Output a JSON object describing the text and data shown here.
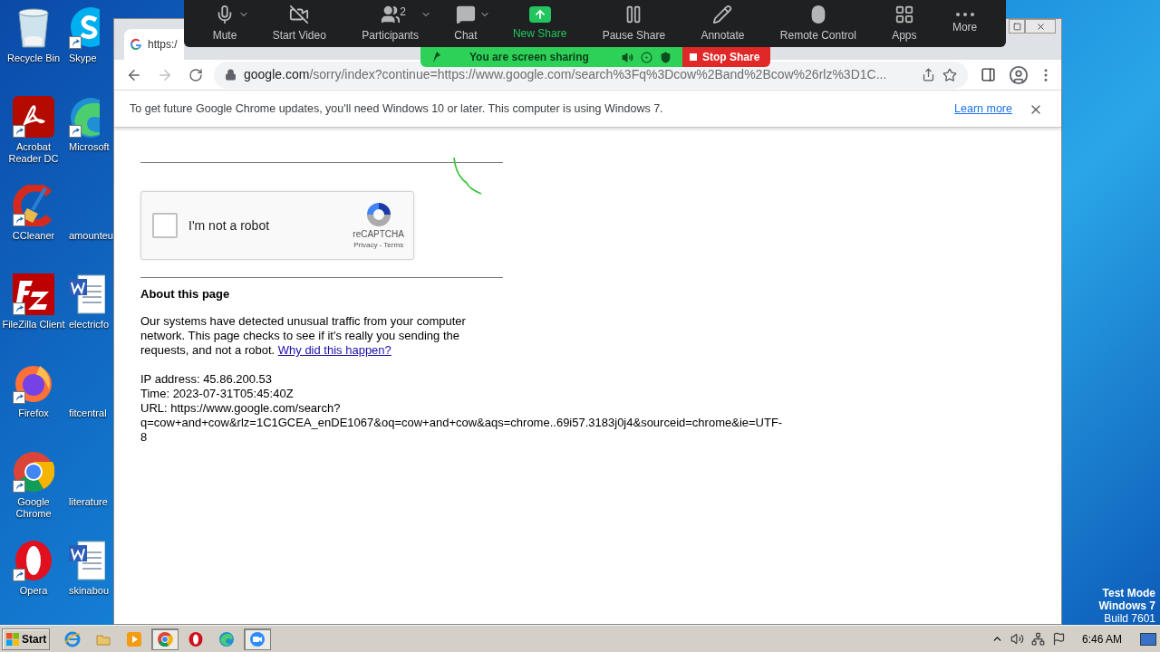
{
  "desktop": {
    "icons": [
      {
        "label": "Recycle Bin",
        "shortcut": false
      },
      {
        "label": "Acrobat Reader DC",
        "shortcut": true
      },
      {
        "label": "CCleaner",
        "shortcut": true
      },
      {
        "label": "FileZilla Client",
        "shortcut": true
      },
      {
        "label": "Firefox",
        "shortcut": true
      },
      {
        "label": "Google Chrome",
        "shortcut": true
      },
      {
        "label": "Opera",
        "shortcut": true
      }
    ],
    "icons_column_2": [
      {
        "label": "Skype",
        "shortcut": true
      },
      {
        "label": "Microsoft",
        "shortcut": true
      },
      {
        "label": "amounteu",
        "shortcut": false
      },
      {
        "label": "electricfo",
        "shortcut": false
      },
      {
        "label": "fitcentral",
        "shortcut": false
      },
      {
        "label": "literature",
        "shortcut": false
      },
      {
        "label": "skinabou",
        "shortcut": false
      }
    ],
    "watermark_lines": [
      "Test Mode",
      "Windows 7",
      "Build 7601"
    ]
  },
  "zoom_toolbar": {
    "buttons": [
      {
        "label": "Mute",
        "has_menu": true,
        "active": false
      },
      {
        "label": "Start Video",
        "has_menu": false,
        "active": false
      },
      {
        "label": "Participants",
        "has_menu": true,
        "active": false,
        "badge": "2"
      },
      {
        "label": "Chat",
        "has_menu": true,
        "active": false
      },
      {
        "label": "New Share",
        "has_menu": false,
        "active": true
      },
      {
        "label": "Pause Share",
        "has_menu": false,
        "active": false
      },
      {
        "label": "Annotate",
        "has_menu": false,
        "active": false
      },
      {
        "label": "Remote Control",
        "has_menu": false,
        "active": false
      },
      {
        "label": "Apps",
        "has_menu": false,
        "active": false
      },
      {
        "label": "More",
        "has_menu": false,
        "active": false
      }
    ],
    "sharing_status": "You are screen sharing",
    "stop_button": "Stop Share"
  },
  "browser": {
    "tab_title": "https:/",
    "address_host": "google.com",
    "address_path": "/sorry/index?continue=https://www.google.com/search%3Fq%3Dcow%2Band%2Bcow%26rlz%3D1C...",
    "infobar": {
      "message": "To get future Google Chrome updates, you'll need Windows 10 or later. This computer is using Windows 7.",
      "link": "Learn more"
    }
  },
  "page": {
    "captcha": {
      "label": "I'm not a robot",
      "checked": false,
      "brand": "reCAPTCHA",
      "privacy": "Privacy",
      "separator": " - ",
      "terms": "Terms"
    },
    "heading": "About this page",
    "paragraph": "Our systems have detected unusual traffic from your computer network. This page checks to see if it's really you sending the requests, and not a robot.",
    "paragraph_link": "Why did this happen?",
    "details": [
      "IP address: 45.86.200.53",
      "Time: 2023-07-31T05:45:40Z",
      "URL: https://www.google.com/search?q=cow+and+cow&rlz=1C1GCEA_enDE1067&oq=cow+and+cow&aqs=chrome..69i57.3183j0j4&sourceid=chrome&ie=UTF-8"
    ]
  },
  "taskbar": {
    "start": "Start",
    "apps": [
      {
        "selected": false
      },
      {
        "selected": false
      },
      {
        "selected": false
      },
      {
        "selected": true
      },
      {
        "selected": false
      },
      {
        "selected": false
      },
      {
        "selected": true
      }
    ],
    "clock": "6:46 AM"
  }
}
